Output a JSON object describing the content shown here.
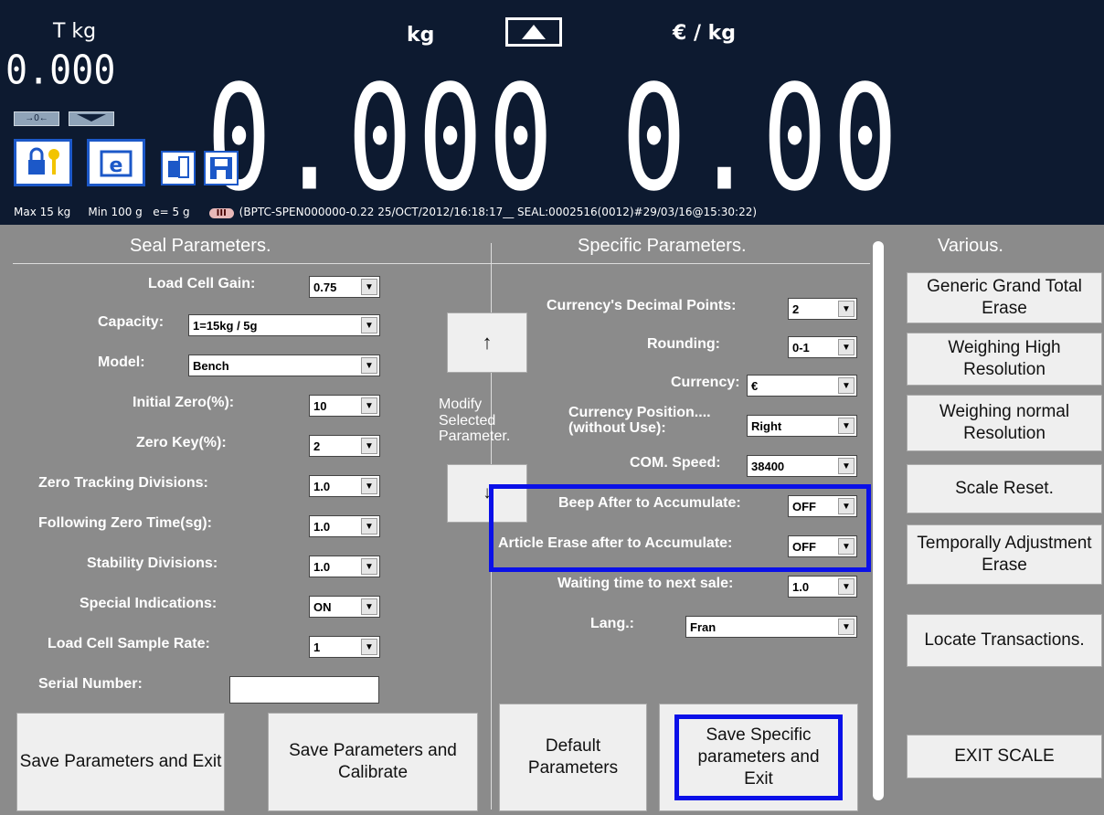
{
  "display": {
    "tare_unit": "T kg",
    "tare_value": "0.000",
    "weight_unit": "kg",
    "weight_value": "0.000",
    "price_unit": "€ / kg",
    "price_value": "0.00",
    "zero_indicator": "→0←",
    "info": {
      "max": "Max 15 kg",
      "min": "Min  100 g",
      "e": "e= 5 g",
      "class_badge": "III",
      "seal_text": "(BPTC-SPEN000000-0.22 25/OCT/2012/16:18:17__ SEAL:0002516(0012)#29/03/16@15:30:22)"
    }
  },
  "seal": {
    "title": "Seal Parameters.",
    "rows": [
      {
        "label": "Load Cell Gain:",
        "value": "0.75"
      },
      {
        "label": "Capacity:",
        "value": "1=15kg / 5g"
      },
      {
        "label": "Model:",
        "value": "Bench"
      },
      {
        "label": "Initial Zero(%):",
        "value": "10"
      },
      {
        "label": "Zero Key(%):",
        "value": "2"
      },
      {
        "label": "Zero Tracking Divisions:",
        "value": "1.0"
      },
      {
        "label": "Following Zero Time(sg):",
        "value": "1.0"
      },
      {
        "label": "Stability Divisions:",
        "value": "1.0"
      },
      {
        "label": "Special Indications:",
        "value": "ON"
      },
      {
        "label": "Load Cell Sample Rate:",
        "value": "1"
      }
    ],
    "serial_label": "Serial Number:",
    "serial_value": "",
    "save_exit": "Save Parameters and Exit",
    "save_calibrate": "Save Parameters and Calibrate"
  },
  "modify": {
    "up": "↑",
    "label": "Modify Selected Parameter."
  },
  "specific": {
    "title": "Specific Parameters.",
    "rows": [
      {
        "label": "Currency's Decimal Points:",
        "value": "2"
      },
      {
        "label": "Rounding:",
        "value": "0-1"
      },
      {
        "label": "Currency:",
        "value": "€"
      },
      {
        "label": "Currency Position.... (without Use):",
        "value": "Right"
      },
      {
        "label": "COM. Speed:",
        "value": "38400"
      },
      {
        "label": "Beep After to Accumulate:",
        "value": "OFF"
      },
      {
        "label": "Article Erase after to Accumulate:",
        "value": "OFF"
      },
      {
        "label": "Waiting time to next sale:",
        "value": "1.0"
      },
      {
        "label": "Lang.:",
        "value": "Fran"
      }
    ],
    "default": "Default Parameters",
    "save_exit": "Save Specific parameters and Exit"
  },
  "various": {
    "title": "Various.",
    "buttons": [
      "Generic Grand Total Erase",
      "Weighing High Resolution",
      "Weighing normal Resolution",
      "Scale Reset.",
      "Temporally Adjustment Erase",
      "Locate Transactions.",
      "EXIT SCALE"
    ]
  }
}
